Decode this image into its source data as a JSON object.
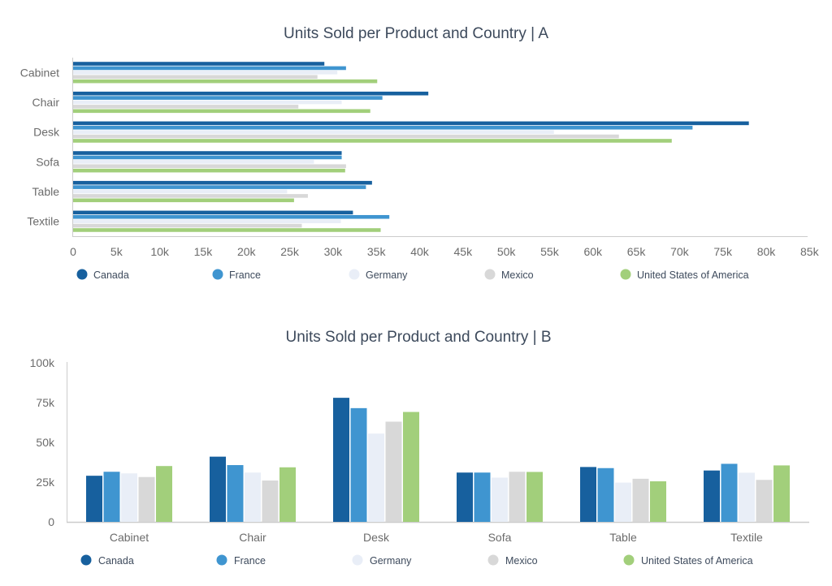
{
  "chart_data": [
    {
      "type": "bar",
      "orientation": "horizontal",
      "title": "Units Sold per Product and Country | A",
      "xlabel": "",
      "ylabel": "",
      "xlim": [
        0,
        85000
      ],
      "x_ticks": [
        "0",
        "5k",
        "10k",
        "15k",
        "20k",
        "25k",
        "30k",
        "35k",
        "40k",
        "45k",
        "50k",
        "55k",
        "60k",
        "65k",
        "70k",
        "75k",
        "80k",
        "85k"
      ],
      "x_tick_values": [
        0,
        5000,
        10000,
        15000,
        20000,
        25000,
        30000,
        35000,
        40000,
        45000,
        50000,
        55000,
        60000,
        65000,
        70000,
        75000,
        80000,
        85000
      ],
      "categories": [
        "Cabinet",
        "Chair",
        "Desk",
        "Sofa",
        "Table",
        "Textile"
      ],
      "grid": false,
      "legend_position": "bottom",
      "series": [
        {
          "name": "Canada",
          "color": "#17609e",
          "values": [
            29000,
            41000,
            78000,
            31000,
            34500,
            32300
          ]
        },
        {
          "name": "France",
          "color": "#3f95d0",
          "values": [
            31500,
            35700,
            71500,
            31000,
            33800,
            36500
          ]
        },
        {
          "name": "Germany",
          "color": "#e9eef7",
          "values": [
            30500,
            31000,
            55500,
            27800,
            24700,
            30900
          ]
        },
        {
          "name": "Mexico",
          "color": "#d8d8d8",
          "values": [
            28200,
            26000,
            63000,
            31500,
            27100,
            26400
          ]
        },
        {
          "name": "United States of America",
          "color": "#a2cf7b",
          "values": [
            35100,
            34300,
            69100,
            31400,
            25500,
            35500
          ]
        }
      ]
    },
    {
      "type": "bar",
      "orientation": "vertical",
      "title": "Units Sold per Product and Country | B",
      "xlabel": "",
      "ylabel": "",
      "ylim": [
        0,
        100000
      ],
      "y_ticks": [
        "0",
        "25k",
        "50k",
        "75k",
        "100k"
      ],
      "y_tick_values": [
        0,
        25000,
        50000,
        75000,
        100000
      ],
      "categories": [
        "Cabinet",
        "Chair",
        "Desk",
        "Sofa",
        "Table",
        "Textile"
      ],
      "grid": false,
      "legend_position": "bottom",
      "series": [
        {
          "name": "Canada",
          "color": "#17609e",
          "values": [
            29000,
            41000,
            78000,
            31000,
            34500,
            32300
          ]
        },
        {
          "name": "France",
          "color": "#3f95d0",
          "values": [
            31500,
            35700,
            71500,
            31000,
            33800,
            36500
          ]
        },
        {
          "name": "Germany",
          "color": "#e9eef7",
          "values": [
            30500,
            31000,
            55500,
            27800,
            24700,
            30900
          ]
        },
        {
          "name": "Mexico",
          "color": "#d8d8d8",
          "values": [
            28200,
            26000,
            63000,
            31500,
            27100,
            26400
          ]
        },
        {
          "name": "United States of America",
          "color": "#a2cf7b",
          "values": [
            35100,
            34300,
            69100,
            31400,
            25500,
            35500
          ]
        }
      ]
    }
  ]
}
